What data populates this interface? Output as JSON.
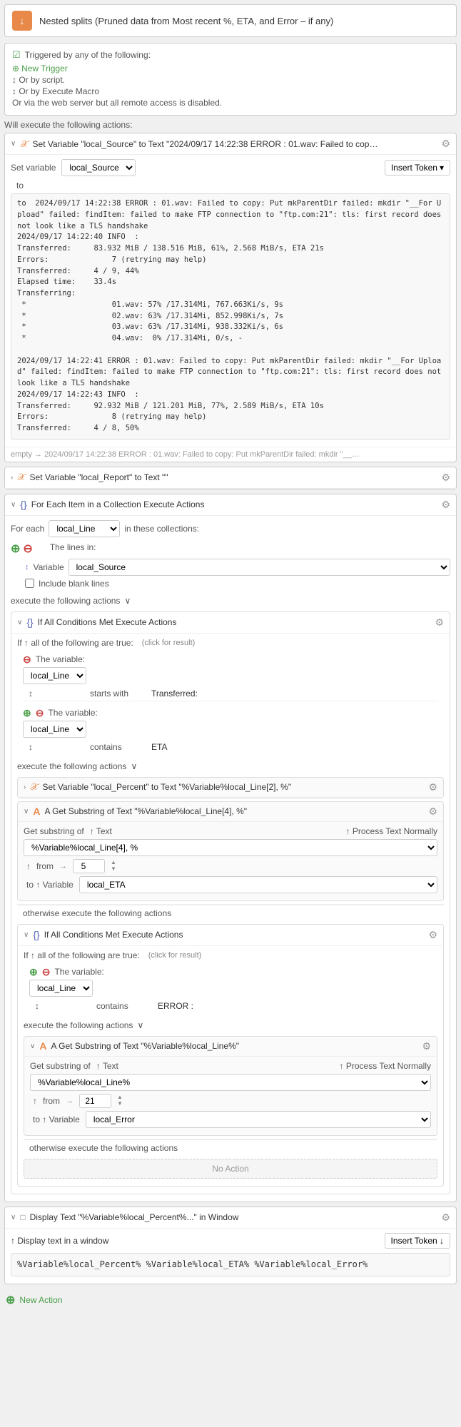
{
  "header": {
    "title": "Nested splits (Pruned data from Most recent %, ETA, and Error – if any)",
    "icon": "↓"
  },
  "trigger_section": {
    "triggered_by": "Triggered by any of the following:",
    "new_trigger": "New Trigger",
    "or_by_script": "Or by script.",
    "or_by_macro": "Or by Execute Macro",
    "or_via": "Or via the web server but all remote access is disabled."
  },
  "execute_label": "Will execute the following actions:",
  "set_variable_action": {
    "title": "Set Variable \"local_Source\" to Text \"2024/09/17 14:22:38 ERROR : 01.wav: Failed to cop…",
    "set_variable_label": "Set variable",
    "variable_name": "local_Source",
    "insert_token": "Insert Token",
    "to_text": "to  2024/09/17 14:22:38 ERROR : 01.wav: Failed to copy: Put mkParentDir failed: mkdir \"__For Upload\" failed: findItem: failed to make FTP connection to \"ftp.com:21\": tls: first record does not look like a TLS handshake\n2024/09/17 14:22:40 INFO  :\nTransferred:     83.932 MiB / 138.516 MiB, 61%, 2.568 MiB/s, ETA 21s\nErrors:              7 (retrying may help)\nTransferred:     4 / 9, 44%\nElapsed time:    33.4s\nTransferring:\n *                   01.wav: 57% /17.314Mi, 767.663Ki/s, 9s\n *                   02.wav: 63% /17.314Mi, 852.998Ki/s, 7s\n *                   03.wav: 63% /17.314Mi, 938.332Ki/s, 6s\n *                   04.wav:  0% /17.314Mi, 0/s, -\n\n2024/09/17 14:22:41 ERROR : 01.wav: Failed to copy: Put mkParentDir failed: mkdir \"__For Upload\" failed: findItem: failed to make FTP connection to \"ftp.com:21\": tls: first record does not look like a TLS handshake\n2024/09/17 14:22:43 INFO  :\nTransferred:     92.932 MiB / 121.201 MiB, 77%, 2.589 MiB/s, ETA 10s\nErrors:              8 (retrying may help)\nTransferred:     4 / 8, 50%"
  },
  "empty_arrow": "empty → 2024/09/17 14:22:38 ERROR : 01.wav: Failed to copy: Put mkParentDir failed: mkdir \"__…",
  "set_variable_report": {
    "title": "Set Variable \"local_Report\" to Text \"\""
  },
  "for_each_block": {
    "title": "For Each Item in a Collection Execute Actions",
    "for_each_label": "For each",
    "variable": "local_Line",
    "in_these_collections": "in these collections:",
    "the_lines_in": "The lines in:",
    "variable_source": "local_Source",
    "include_blank_lines": "Include blank lines",
    "execute_label": "execute the following actions",
    "conditions_block": {
      "title": "If All Conditions Met Execute Actions",
      "if_all_label": "If ↑ all of the following are true:",
      "click_result": "(click for result)",
      "condition1": {
        "the_variable": "The variable:",
        "variable": "local_Line",
        "operator": "starts with",
        "value": "Transferred:"
      },
      "condition2": {
        "the_variable": "The variable:",
        "variable": "local_Line",
        "operator": "contains",
        "value": "ETA"
      },
      "execute_label": "execute the following actions",
      "set_local_percent": {
        "title": "Set Variable \"local_Percent\" to Text \"%Variable%local_Line[2], %\""
      },
      "get_substring": {
        "title": "A  Get Substring of Text \"%Variable%local_Line[4], %\"",
        "get_substring_label": "Get substring of",
        "text_label": "↑ Text",
        "process_label": "↑ Process Text Normally",
        "text_value": "%Variable%local_Line[4], %",
        "from_label": "↑ from",
        "from_value": "5",
        "to_label": "to ↑ Variable",
        "to_variable": "local_ETA"
      }
    },
    "otherwise_block": {
      "otherwise_label": "otherwise execute the following actions",
      "inner_conditions": {
        "title": "If All Conditions Met Execute Actions",
        "if_all_label": "If ↑ all of the following are true:",
        "click_result": "(click for result)",
        "condition1": {
          "the_variable": "The variable:",
          "variable": "local_Line",
          "operator": "contains",
          "value": "ERROR :"
        },
        "execute_label": "execute the following actions",
        "get_substring": {
          "title": "A  Get Substring of Text \"%Variable%local_Line%\"",
          "get_substring_label": "Get substring of",
          "text_label": "↑ Text",
          "process_label": "↑ Process Text Normally",
          "text_value": "%Variable%local_Line%",
          "from_label": "↑ from",
          "from_value": "21",
          "to_label": "to ↑ Variable",
          "to_variable": "local_Error"
        },
        "otherwise_label": "otherwise execute the following actions",
        "no_action": "No Action"
      }
    }
  },
  "display_text_block": {
    "title": "Display Text \"%Variable%local_Percent%...\" in Window",
    "display_sub": "↑ Display text in a window",
    "insert_token": "Insert Token ↓",
    "content": "%Variable%local_Percent%\n%Variable%local_ETA%\n\n%Variable%local_Error%"
  },
  "new_action": "New Action"
}
